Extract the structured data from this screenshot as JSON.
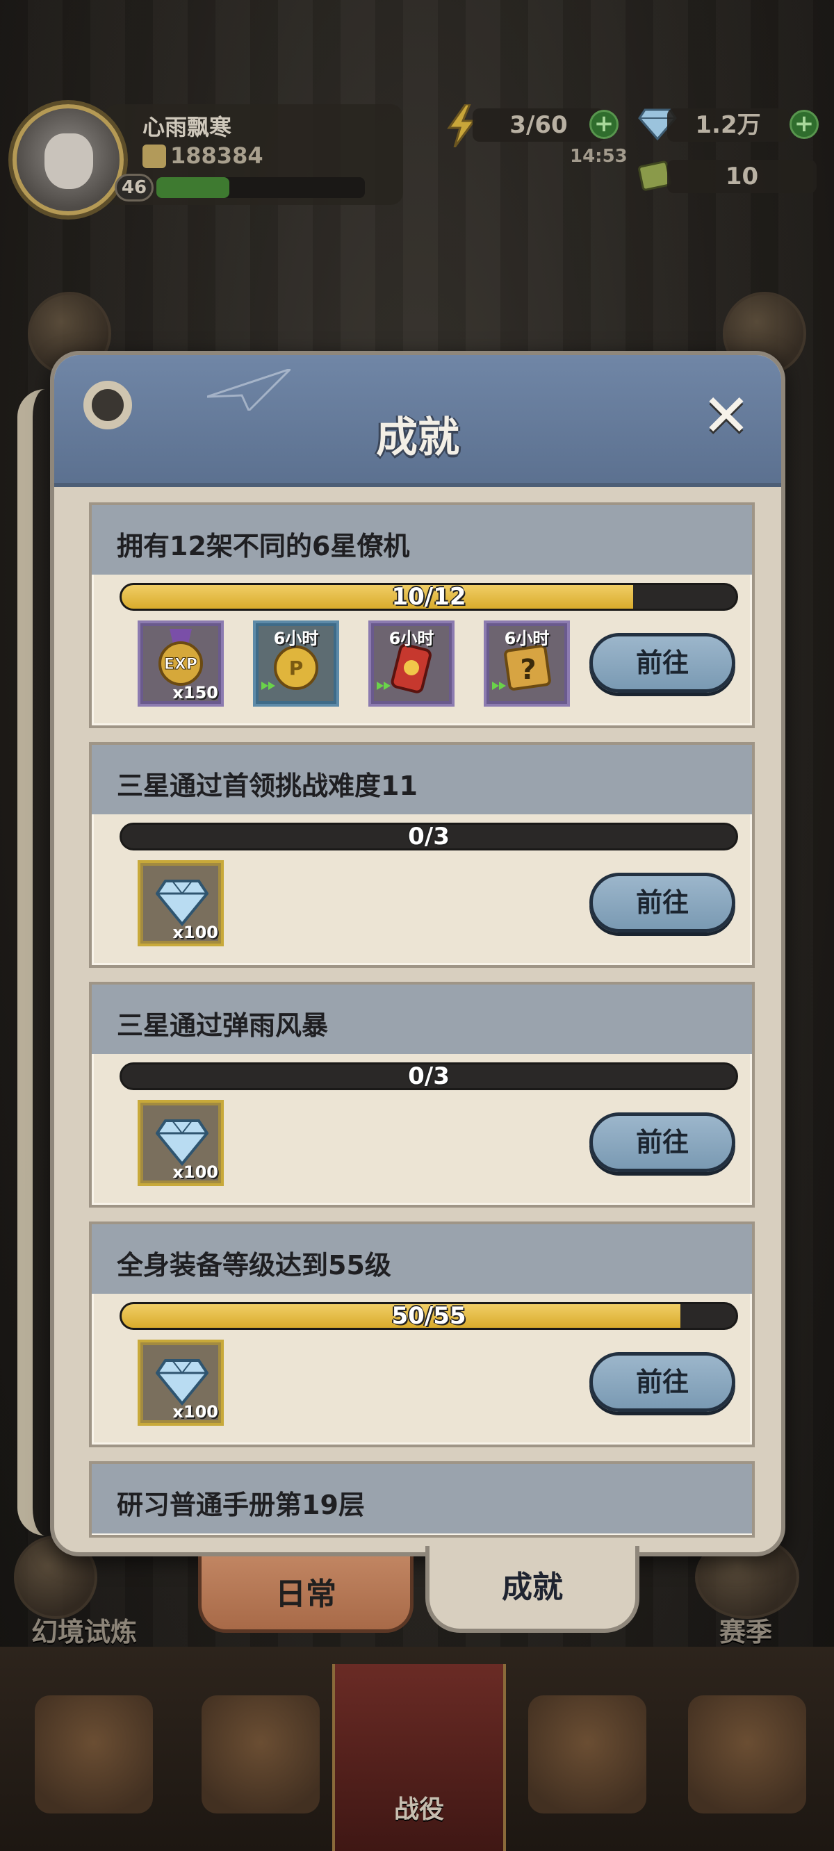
{
  "player": {
    "name": "心雨飘寒",
    "power": "188384",
    "level": "46",
    "xp_fraction": 0.35
  },
  "resources": {
    "stamina": "3/60",
    "diamonds": "1.2万",
    "timer": "14:53",
    "tickets": "10"
  },
  "background": {
    "left_mode_label": "幻境试炼",
    "right_mode_label": "赛季",
    "center_nav_label": "战役"
  },
  "panel": {
    "title": "成就",
    "close_symbol": "✕"
  },
  "achievements": [
    {
      "title": "拥有12架不同的6星僚机",
      "progress_text": "10/12",
      "progress": 0.833,
      "go_label": "前往",
      "rewards": [
        {
          "icon": "exp-medal-icon",
          "count": "x150",
          "time": "",
          "frame": "purple"
        },
        {
          "icon": "gold-coin-boost-icon",
          "count": "",
          "time": "6小时",
          "frame": "blue"
        },
        {
          "icon": "red-can-boost-icon",
          "count": "",
          "time": "6小时",
          "frame": "purple"
        },
        {
          "icon": "mystery-scroll-boost-icon",
          "count": "",
          "time": "6小时",
          "frame": "purple"
        }
      ]
    },
    {
      "title": "三星通过首领挑战难度11",
      "progress_text": "0/3",
      "progress": 0,
      "go_label": "前往",
      "rewards": [
        {
          "icon": "diamond-icon",
          "count": "x100",
          "time": "",
          "frame": "gold"
        }
      ]
    },
    {
      "title": "三星通过弹雨风暴",
      "progress_text": "0/3",
      "progress": 0,
      "go_label": "前往",
      "rewards": [
        {
          "icon": "diamond-icon",
          "count": "x100",
          "time": "",
          "frame": "gold"
        }
      ]
    },
    {
      "title": "全身装备等级达到55级",
      "progress_text": "50/55",
      "progress": 0.909,
      "go_label": "前往",
      "rewards": [
        {
          "icon": "diamond-icon",
          "count": "x100",
          "time": "",
          "frame": "gold"
        }
      ]
    },
    {
      "title": "研习普通手册第19层"
    }
  ],
  "tabs": {
    "daily": "日常",
    "achievements": "成就"
  },
  "colors": {
    "header_blue": "#6a7f9f",
    "progress_gold": "#e3b83c",
    "card_bg": "#ece4d4",
    "card_head": "#9aa3ad"
  }
}
